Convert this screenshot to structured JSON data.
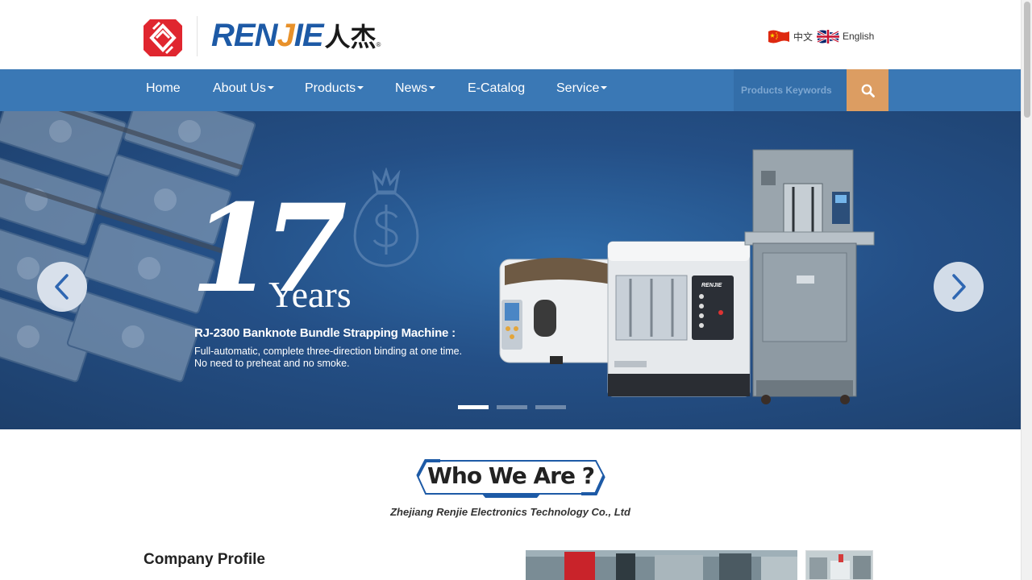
{
  "brand": {
    "logo_latin_a": "REN",
    "logo_latin_b": "J",
    "logo_latin_c": "IE",
    "logo_cn": "人杰",
    "logo_reg": "®",
    "primary_color": "#1d5aa6",
    "accent_color": "#e8912a",
    "mark_color": "#e0262f"
  },
  "languages": [
    {
      "label": "中文",
      "flag": "china-flag-icon"
    },
    {
      "label": "English",
      "flag": "uk-flag-icon"
    }
  ],
  "nav": {
    "items": [
      {
        "label": "Home",
        "has_dropdown": false
      },
      {
        "label": "About Us",
        "has_dropdown": true
      },
      {
        "label": "Products",
        "has_dropdown": true
      },
      {
        "label": "News",
        "has_dropdown": true
      },
      {
        "label": "E-Catalog",
        "has_dropdown": false
      },
      {
        "label": "Service",
        "has_dropdown": true
      }
    ],
    "search_placeholder": "Products Keywords",
    "nav_color": "#3a78b5",
    "search_button_color": "#dc9d62"
  },
  "banner": {
    "years_number": "17",
    "years_word": "Years",
    "title": "RJ-2300  Banknote Bundle Strapping Machine :",
    "line1": "Full-automatic, complete three-direction binding at one time.",
    "line2": "No need to preheat and no smoke.",
    "machine_badge": "RENJIE",
    "slide_count": 3,
    "active_slide": 1
  },
  "intro": {
    "heading": "Who We Are ?",
    "company": "Zhejiang Renjie Electronics Technology Co., Ltd"
  },
  "profile": {
    "heading": "Company Profile"
  }
}
